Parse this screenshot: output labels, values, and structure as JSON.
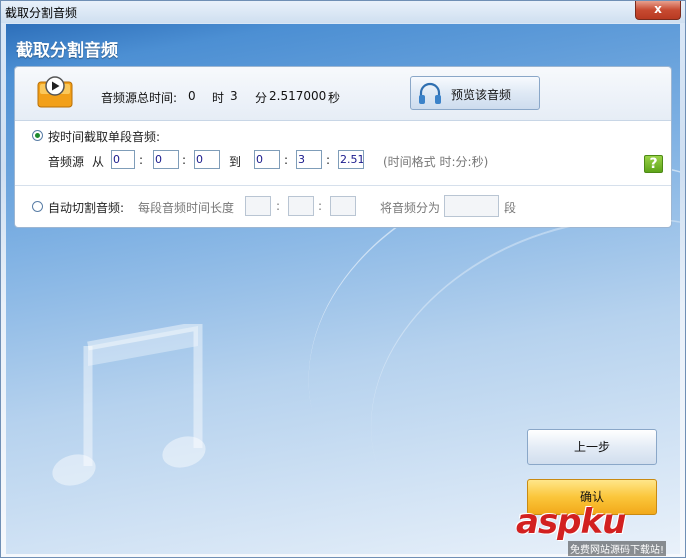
{
  "window": {
    "title": "截取分割音频",
    "close_label": "x"
  },
  "header": {
    "title": "截取分割音频"
  },
  "info": {
    "total_time_label": "音频源总时间:",
    "hours": "0",
    "hours_unit": "时",
    "minutes": "3",
    "minutes_unit": "分",
    "seconds": "2.517000",
    "seconds_unit": "秒",
    "preview_label": "预览该音频"
  },
  "single": {
    "radio_label": "按时间截取单段音频:",
    "selected": true,
    "source_label": "音频源",
    "from_label": "从",
    "to_label": "到",
    "colon": ":",
    "start": [
      "0",
      "0",
      "0"
    ],
    "end": [
      "0",
      "3",
      "2.51"
    ],
    "format_hint": "(时间格式 时:分:秒)"
  },
  "auto": {
    "radio_label": "自动切割音频:",
    "selected": false,
    "segment_length_label": "每段音频时间长度",
    "segment_length": [
      "",
      "",
      ""
    ],
    "split_into_label": "将音频分为",
    "split_count": "",
    "segment_unit": "段"
  },
  "buttons": {
    "prev": "上一步",
    "confirm": "确认"
  },
  "watermark": {
    "text": "aspku",
    "sub": "免费网站源码下载站!"
  },
  "colors": {
    "help": "#6ab31f",
    "confirm": "#fbc63b",
    "watermark": "#d22020"
  }
}
